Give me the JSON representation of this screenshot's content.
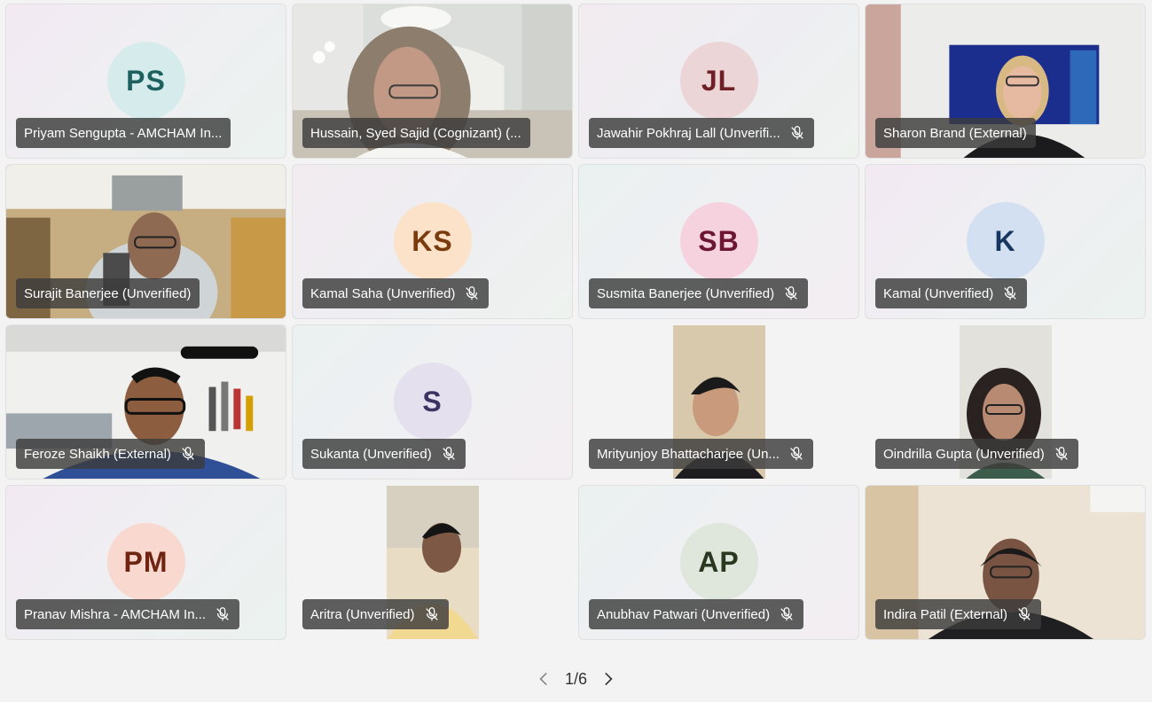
{
  "participants": [
    {
      "name": "Priyam Sengupta - AMCHAM In...",
      "initials": "PS",
      "muted": false,
      "video": false,
      "avatar_bg": "#d6ecec",
      "avatar_fg": "#1f6160"
    },
    {
      "name": "Hussain, Syed Sajid (Cognizant) (...",
      "initials": "",
      "muted": false,
      "video": true
    },
    {
      "name": "Jawahir Pokhraj Lall (Unverifi...",
      "initials": "JL",
      "muted": true,
      "video": false,
      "avatar_bg": "#ecd5d6",
      "avatar_fg": "#6e2026"
    },
    {
      "name": "Sharon Brand (External)",
      "initials": "",
      "muted": false,
      "video": true
    },
    {
      "name": "Surajit Banerjee (Unverified)",
      "initials": "",
      "muted": false,
      "video": true
    },
    {
      "name": "Kamal Saha (Unverified)",
      "initials": "KS",
      "muted": true,
      "video": false,
      "avatar_bg": "#fbe2c8",
      "avatar_fg": "#7a3b0f"
    },
    {
      "name": "Susmita Banerjee (Unverified)",
      "initials": "SB",
      "muted": true,
      "video": false,
      "avatar_bg": "#f6d2de",
      "avatar_fg": "#6d1633"
    },
    {
      "name": "Kamal (Unverified)",
      "initials": "K",
      "muted": true,
      "video": false,
      "avatar_bg": "#d2e0f1",
      "avatar_fg": "#16365f"
    },
    {
      "name": "Feroze Shaikh (External)",
      "initials": "",
      "muted": true,
      "video": true
    },
    {
      "name": "Sukanta (Unverified)",
      "initials": "S",
      "muted": true,
      "video": false,
      "avatar_bg": "#e4e0ee",
      "avatar_fg": "#3d3261"
    },
    {
      "name": "Mrityunjoy Bhattacharjee (Un...",
      "initials": "",
      "muted": true,
      "video": true
    },
    {
      "name": "Oindrilla Gupta (Unverified)",
      "initials": "",
      "muted": true,
      "video": true
    },
    {
      "name": "Pranav Mishra - AMCHAM In...",
      "initials": "PM",
      "muted": true,
      "video": false,
      "avatar_bg": "#f8d8cf",
      "avatar_fg": "#6e2410"
    },
    {
      "name": "Aritra (Unverified)",
      "initials": "",
      "muted": true,
      "video": true
    },
    {
      "name": "Anubhav Patwari (Unverified)",
      "initials": "AP",
      "muted": true,
      "video": false,
      "avatar_bg": "#dfe6dc",
      "avatar_fg": "#29381f"
    },
    {
      "name": "Indira Patil (External)",
      "initials": "",
      "muted": true,
      "video": true
    }
  ],
  "pager": {
    "text": "1/6"
  },
  "icons": {
    "mic": "mic-off-icon",
    "prev": "chevron-left-icon",
    "next": "chevron-right-icon"
  }
}
